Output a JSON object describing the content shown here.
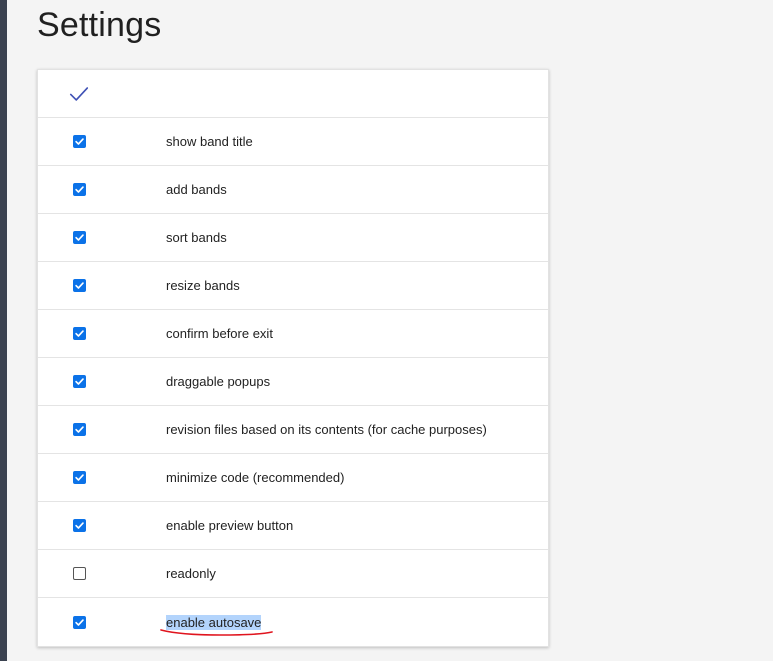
{
  "page": {
    "title": "Settings"
  },
  "table": {
    "header": {
      "check_icon": "checkmark-icon"
    },
    "rows": [
      {
        "label": "show band title",
        "checked": true
      },
      {
        "label": "add bands",
        "checked": true
      },
      {
        "label": "sort bands",
        "checked": true
      },
      {
        "label": "resize bands",
        "checked": true
      },
      {
        "label": "confirm before exit",
        "checked": true
      },
      {
        "label": "draggable popups",
        "checked": true
      },
      {
        "label": "revision files based on its contents (for cache purposes)",
        "checked": true
      },
      {
        "label": "minimize code (recommended)",
        "checked": true
      },
      {
        "label": "enable preview button",
        "checked": true
      },
      {
        "label": "readonly",
        "checked": false
      },
      {
        "label": "enable autosave",
        "checked": true,
        "selected": true
      }
    ]
  },
  "colors": {
    "accent": "#0b72e8",
    "header_check": "#3f51b5",
    "selection_highlight": "#b3d4fc",
    "annotation_underline": "#e0141e",
    "sidebar": "#3b4250"
  }
}
